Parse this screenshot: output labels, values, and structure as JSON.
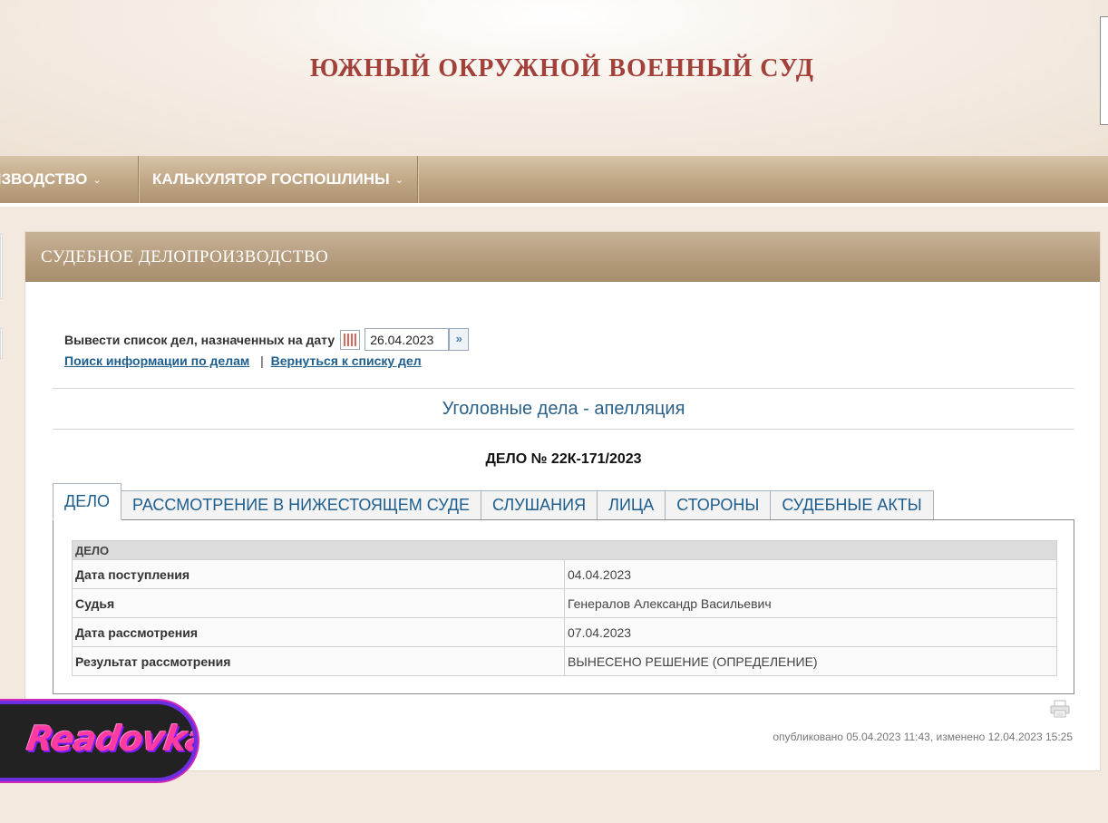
{
  "header": {
    "title": "ЮЖНЫЙ ОКРУЖНОЙ ВОЕННЫЙ СУД"
  },
  "nav": {
    "items": [
      {
        "label": "ОИЗВОДСТВО",
        "chevron": "⌄"
      },
      {
        "label": "КАЛЬКУЛЯТОР ГОСПОШЛИНЫ",
        "chevron": "⌄"
      }
    ]
  },
  "panel": {
    "title": "СУДЕБНОЕ ДЕЛОПРОИЗВОДСТВО",
    "date_filter": {
      "label": "Вывести список дел, назначенных на дату",
      "value": "26.04.2023",
      "calendar_icon": "calendar-icon",
      "go_icon": "arrow-right-icon"
    },
    "links": {
      "search": "Поиск информации по делам",
      "separator": "|",
      "back": "Вернуться к списку дел"
    },
    "category": "Уголовные дела - апелляция",
    "case_number": "ДЕЛО № 22К-171/2023",
    "tabs": [
      {
        "label": "ДЕЛО",
        "active": true
      },
      {
        "label": "РАССМОТРЕНИЕ В НИЖЕСТОЯЩЕМ СУДЕ",
        "active": false
      },
      {
        "label": "СЛУШАНИЯ",
        "active": false
      },
      {
        "label": "ЛИЦА",
        "active": false
      },
      {
        "label": "СТОРОНЫ",
        "active": false
      },
      {
        "label": "СУДЕБНЫЕ АКТЫ",
        "active": false
      }
    ],
    "table": {
      "header": "ДЕЛО",
      "rows": [
        {
          "label": "Дата поступления",
          "value": "04.04.2023"
        },
        {
          "label": "Судья",
          "value": "Генералов Александр Васильевич"
        },
        {
          "label": "Дата рассмотрения",
          "value": "07.04.2023"
        },
        {
          "label": "Результат рассмотрения",
          "value": "ВЫНЕСЕНО РЕШЕНИЕ (ОПРЕДЕЛЕНИЕ)"
        }
      ]
    },
    "print_icon": "printer-icon",
    "published": "опубликовано 05.04.2023 11:43, изменено 12.04.2023 15:25"
  },
  "watermark": {
    "text": "Readovka"
  },
  "colors": {
    "title_red": "#a2403a",
    "link_blue": "#1d5e8e",
    "nav_brown": "#b29a7b"
  }
}
